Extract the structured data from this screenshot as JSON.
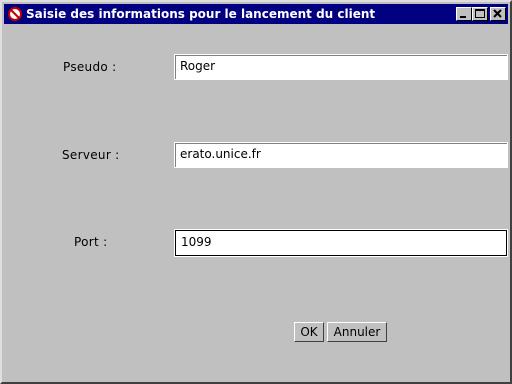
{
  "window": {
    "title": "Saisie des informations pour le lancement du client"
  },
  "titlebar_buttons": {
    "minimize_icon": "minimize-icon",
    "maximize_icon": "maximize-icon",
    "close_icon": "close-icon"
  },
  "form": {
    "pseudo": {
      "label": "Pseudo :",
      "value": "Roger"
    },
    "serveur": {
      "label": "Serveur :",
      "value": "erato.unice.fr"
    },
    "port": {
      "label": "Port :",
      "value": "1099"
    }
  },
  "buttons": {
    "ok": "OK",
    "annuler": "Annuler"
  },
  "colors": {
    "titlebar": "#000080",
    "background": "#c0c0c0"
  }
}
